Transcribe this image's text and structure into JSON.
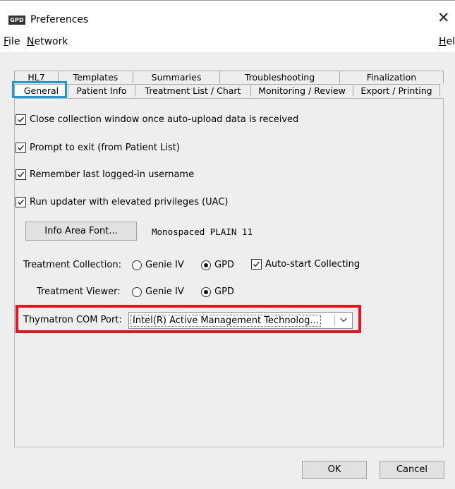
{
  "window": {
    "icon_text": "GPD",
    "title": "Preferences",
    "close_glyph": "✕"
  },
  "menubar": {
    "file": {
      "mnemonic": "F",
      "rest": "ile"
    },
    "network": {
      "mnemonic": "N",
      "rest": "etwork"
    },
    "help": {
      "mnemonic": "H",
      "rest": "elp"
    }
  },
  "tabs": {
    "row1": [
      "HL7",
      "Templates",
      "Summaries",
      "Troubleshooting",
      "Finalization"
    ],
    "row2": [
      "General",
      "Patient Info",
      "Treatment List / Chart",
      "Monitoring / Review",
      "Export / Printing"
    ],
    "selected": "General"
  },
  "general": {
    "checkboxes": [
      {
        "label": "Close collection window once auto-upload data is received",
        "checked": true
      },
      {
        "label": "Prompt to exit (from Patient List)",
        "checked": true
      },
      {
        "label": "Remember last logged-in username",
        "checked": true
      },
      {
        "label": "Run updater with elevated privileges (UAC)",
        "checked": true
      }
    ],
    "font_button": "Info Area Font...",
    "font_value": "Monospaced PLAIN 11",
    "treatment_collection": {
      "label": "Treatment Collection:",
      "options": [
        "Genie IV",
        "GPD"
      ],
      "selected": "GPD",
      "auto_start_label": "Auto-start Collecting",
      "auto_start_checked": true
    },
    "treatment_viewer": {
      "label": "Treatment Viewer:",
      "options": [
        "Genie IV",
        "GPD"
      ],
      "selected": "GPD"
    },
    "com_port": {
      "label": "Thymatron COM Port:",
      "value": "Intel(R) Active Management Technolog..."
    }
  },
  "buttons": {
    "ok": "OK",
    "cancel": "Cancel"
  },
  "highlight_colors": {
    "tab_outline": "#1a9bd8",
    "com_port_outline": "#e8121a"
  }
}
